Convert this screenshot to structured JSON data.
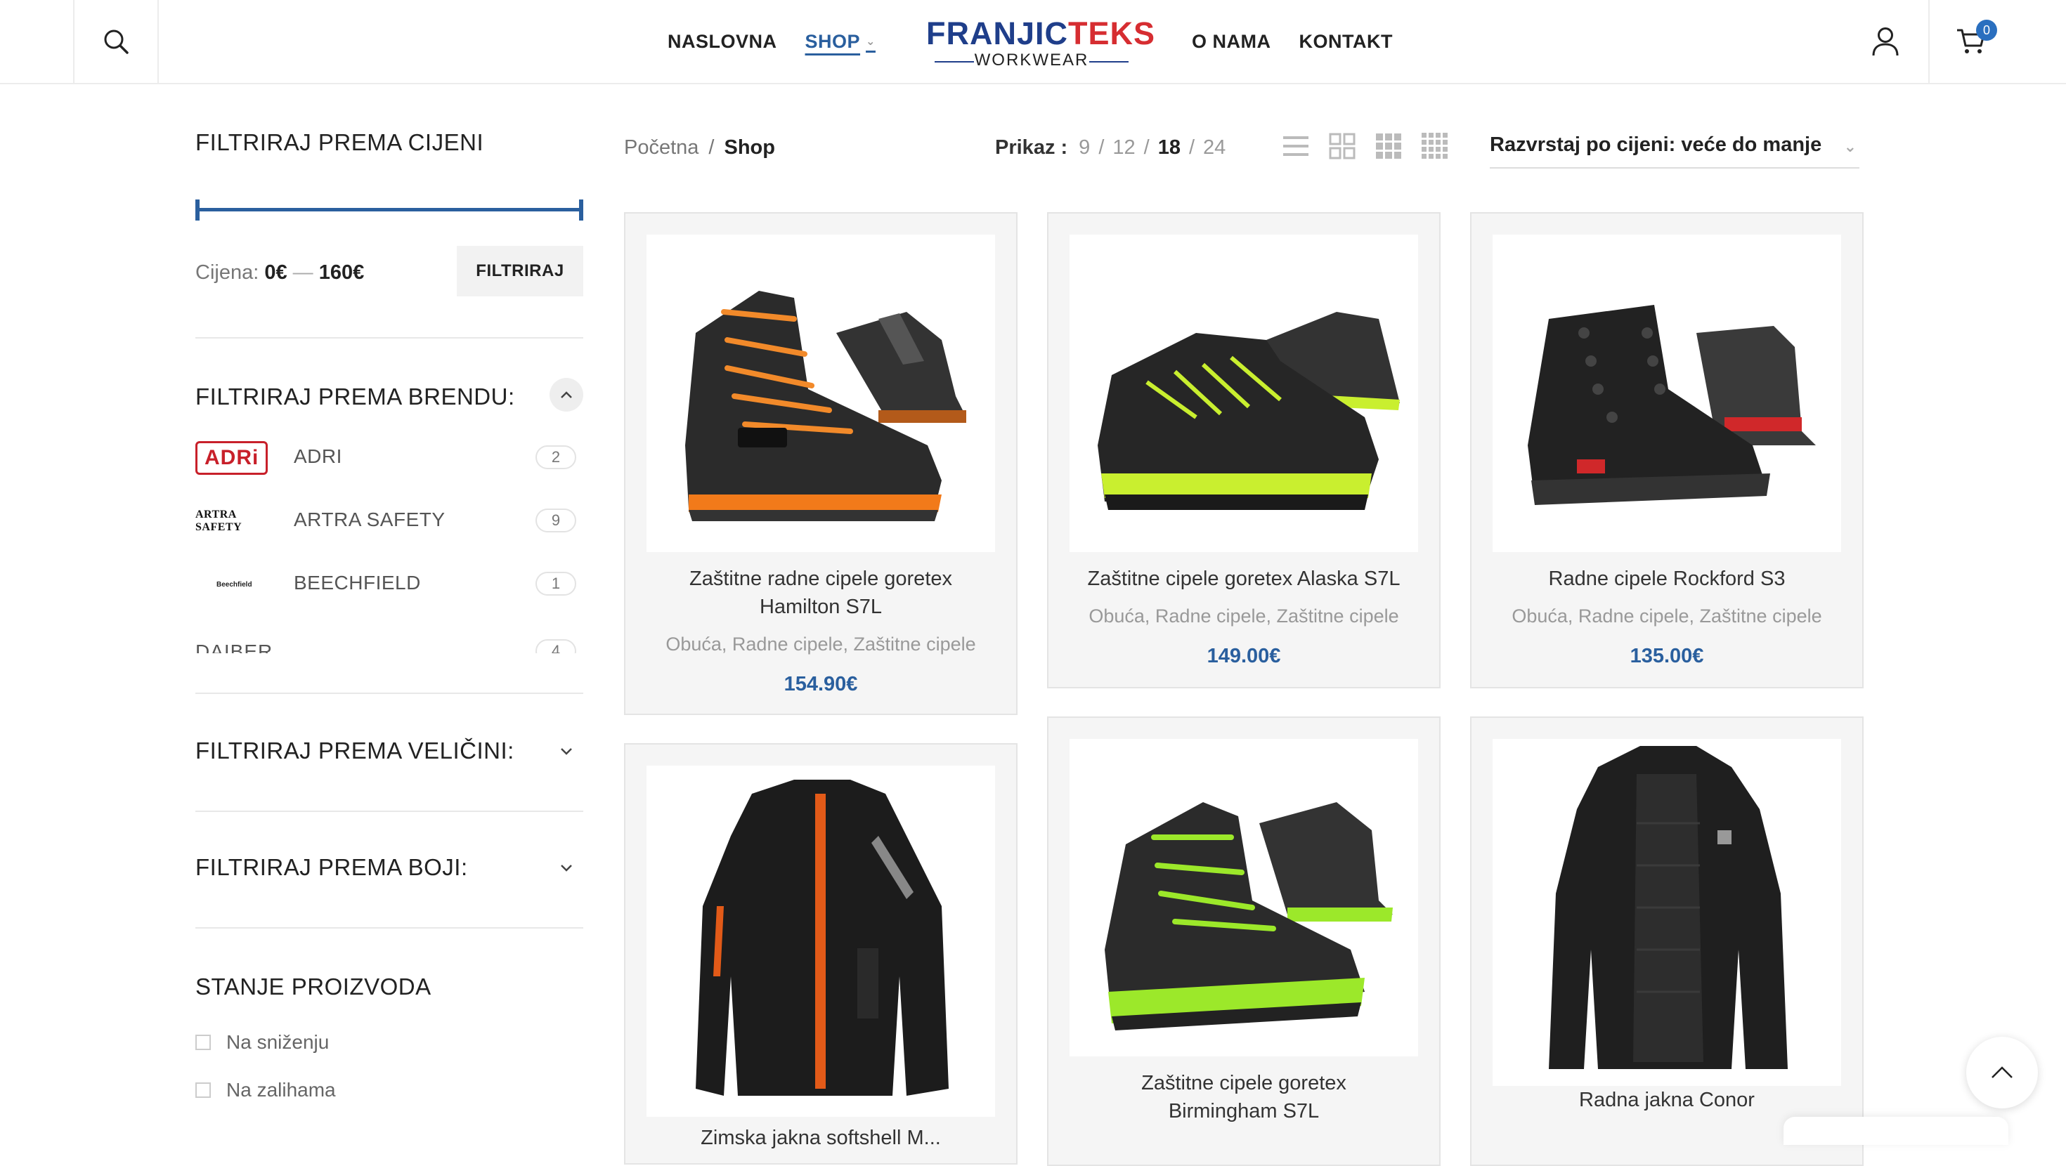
{
  "header": {
    "nav_left": [
      {
        "label": "NASLOVNA"
      },
      {
        "label": "SHOP"
      }
    ],
    "nav_right": [
      {
        "label": "O NAMA"
      },
      {
        "label": "KONTAKT"
      }
    ],
    "logo": {
      "part1": "FRANJIC",
      "part2": "TEKS",
      "sub": "WORKWEAR"
    },
    "cart_count": "0",
    "accent_color": "#2a5f9e",
    "icons": [
      "search-icon",
      "user-icon",
      "cart-icon"
    ]
  },
  "sidebar": {
    "price_filter": {
      "title": "FILTRIRAJ PREMA CIJENI",
      "label": "Cijena:",
      "min": "0€",
      "max": "160€",
      "button": "FILTRIRAJ"
    },
    "brand_filter": {
      "title": "FILTRIRAJ PREMA BRENDU:",
      "brands": [
        {
          "logo_text": "ADRi",
          "name": "ADRI",
          "count": "2"
        },
        {
          "logo_text": "ARTRA SAFETY",
          "name": "ARTRA SAFETY",
          "count": "9"
        },
        {
          "logo_text": "Beechfield",
          "name": "BEECHFIELD",
          "count": "1"
        },
        {
          "logo_text": "DAIBER",
          "name": "DAIBER",
          "count": "4"
        }
      ]
    },
    "size_filter": {
      "title": "FILTRIRAJ PREMA VELIČINI:"
    },
    "color_filter": {
      "title": "FILTRIRAJ PREMA BOJI:"
    },
    "stock": {
      "title": "STANJE PROIZVODA",
      "options": [
        {
          "label": "Na sniženju"
        },
        {
          "label": "Na zalihama"
        }
      ]
    }
  },
  "toolbar": {
    "breadcrumb": {
      "home": "Početna",
      "sep": "/",
      "current": "Shop"
    },
    "per_page": {
      "label": "Prikaz :",
      "options": [
        "9",
        "12",
        "18",
        "24"
      ],
      "selected": "18"
    },
    "sort": "Razvrstaj po cijeni: veće do manje"
  },
  "products": [
    {
      "title_lines": [
        "Zaštitne radne cipele goretex",
        "Hamilton S7L"
      ],
      "categories": "Obuća, Radne cipele, Zaštitne cipele",
      "price": "154.90€",
      "image": "boot-orange-laces"
    },
    {
      "title_lines": [
        "Zaštitne cipele goretex Alaska S7L"
      ],
      "categories": "Obuća, Radne cipele, Zaštitne cipele",
      "price": "149.00€",
      "image": "shoe-yellow-accents"
    },
    {
      "title_lines": [
        "Radne cipele Rockford S3"
      ],
      "categories": "Obuća, Radne cipele, Zaštitne cipele",
      "price": "135.00€",
      "image": "boot-red-sole"
    },
    {
      "title_lines": [
        "Zimska jakna softshell M..."
      ],
      "image": "jacket-orange-zip"
    },
    {
      "title_lines": [
        "Zaštitne cipele goretex",
        "Birmingham S7L"
      ],
      "image": "boot-green-laces"
    },
    {
      "title_lines": [
        "Radna jakna Conor"
      ],
      "image": "jacket-black-parka"
    }
  ]
}
